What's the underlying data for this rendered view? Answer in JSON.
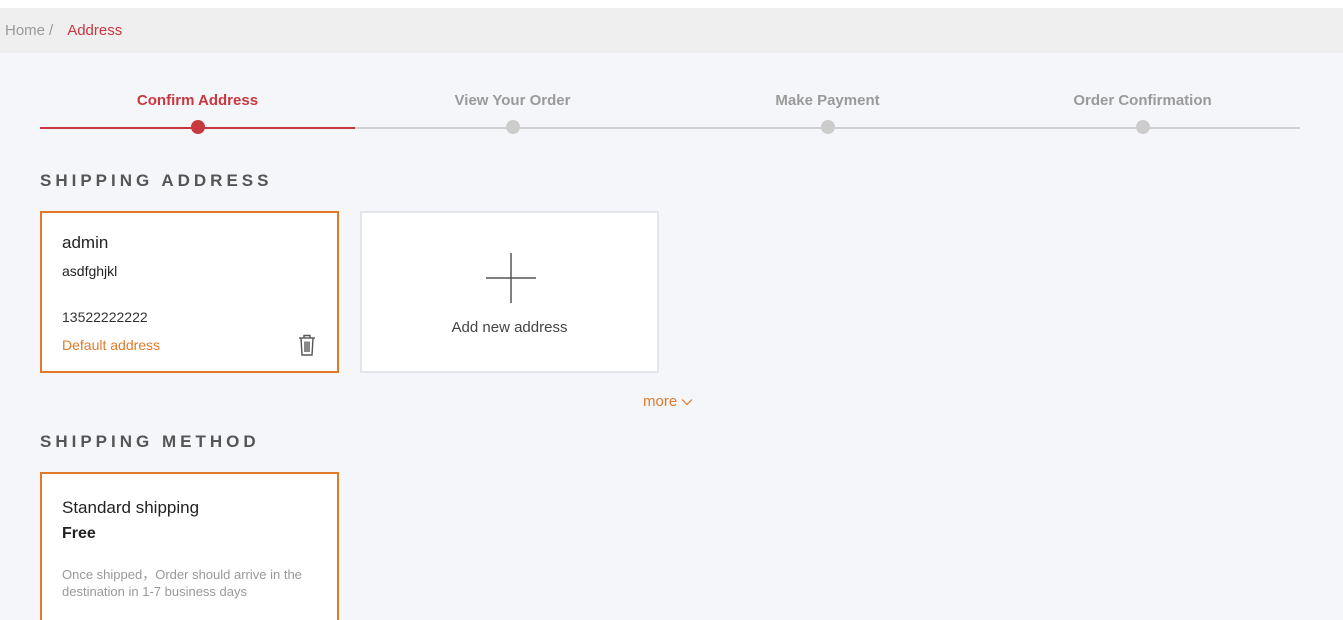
{
  "breadcrumb": {
    "home": "Home",
    "separator": "/",
    "current": "Address"
  },
  "steps": [
    {
      "label": "Confirm Address",
      "active": true
    },
    {
      "label": "View Your Order",
      "active": false
    },
    {
      "label": "Make Payment",
      "active": false
    },
    {
      "label": "Order Confirmation",
      "active": false
    }
  ],
  "shipping_address": {
    "title": "SHIPPING ADDRESS",
    "selected": {
      "name": "admin",
      "street": "asdfghjkl",
      "phone": "13522222222",
      "default_label": "Default address",
      "delete_icon": "trash-icon"
    },
    "add_label": "Add new address",
    "more_label": "more"
  },
  "shipping_method": {
    "title": "SHIPPING METHOD",
    "name": "Standard shipping",
    "price": "Free",
    "description": "Once shipped，Order should arrive in the destination in 1-7 business days"
  },
  "colors": {
    "accent": "#c8393f",
    "selection": "#e07a2a",
    "muted": "#999999",
    "background": "#f5f6fa"
  }
}
